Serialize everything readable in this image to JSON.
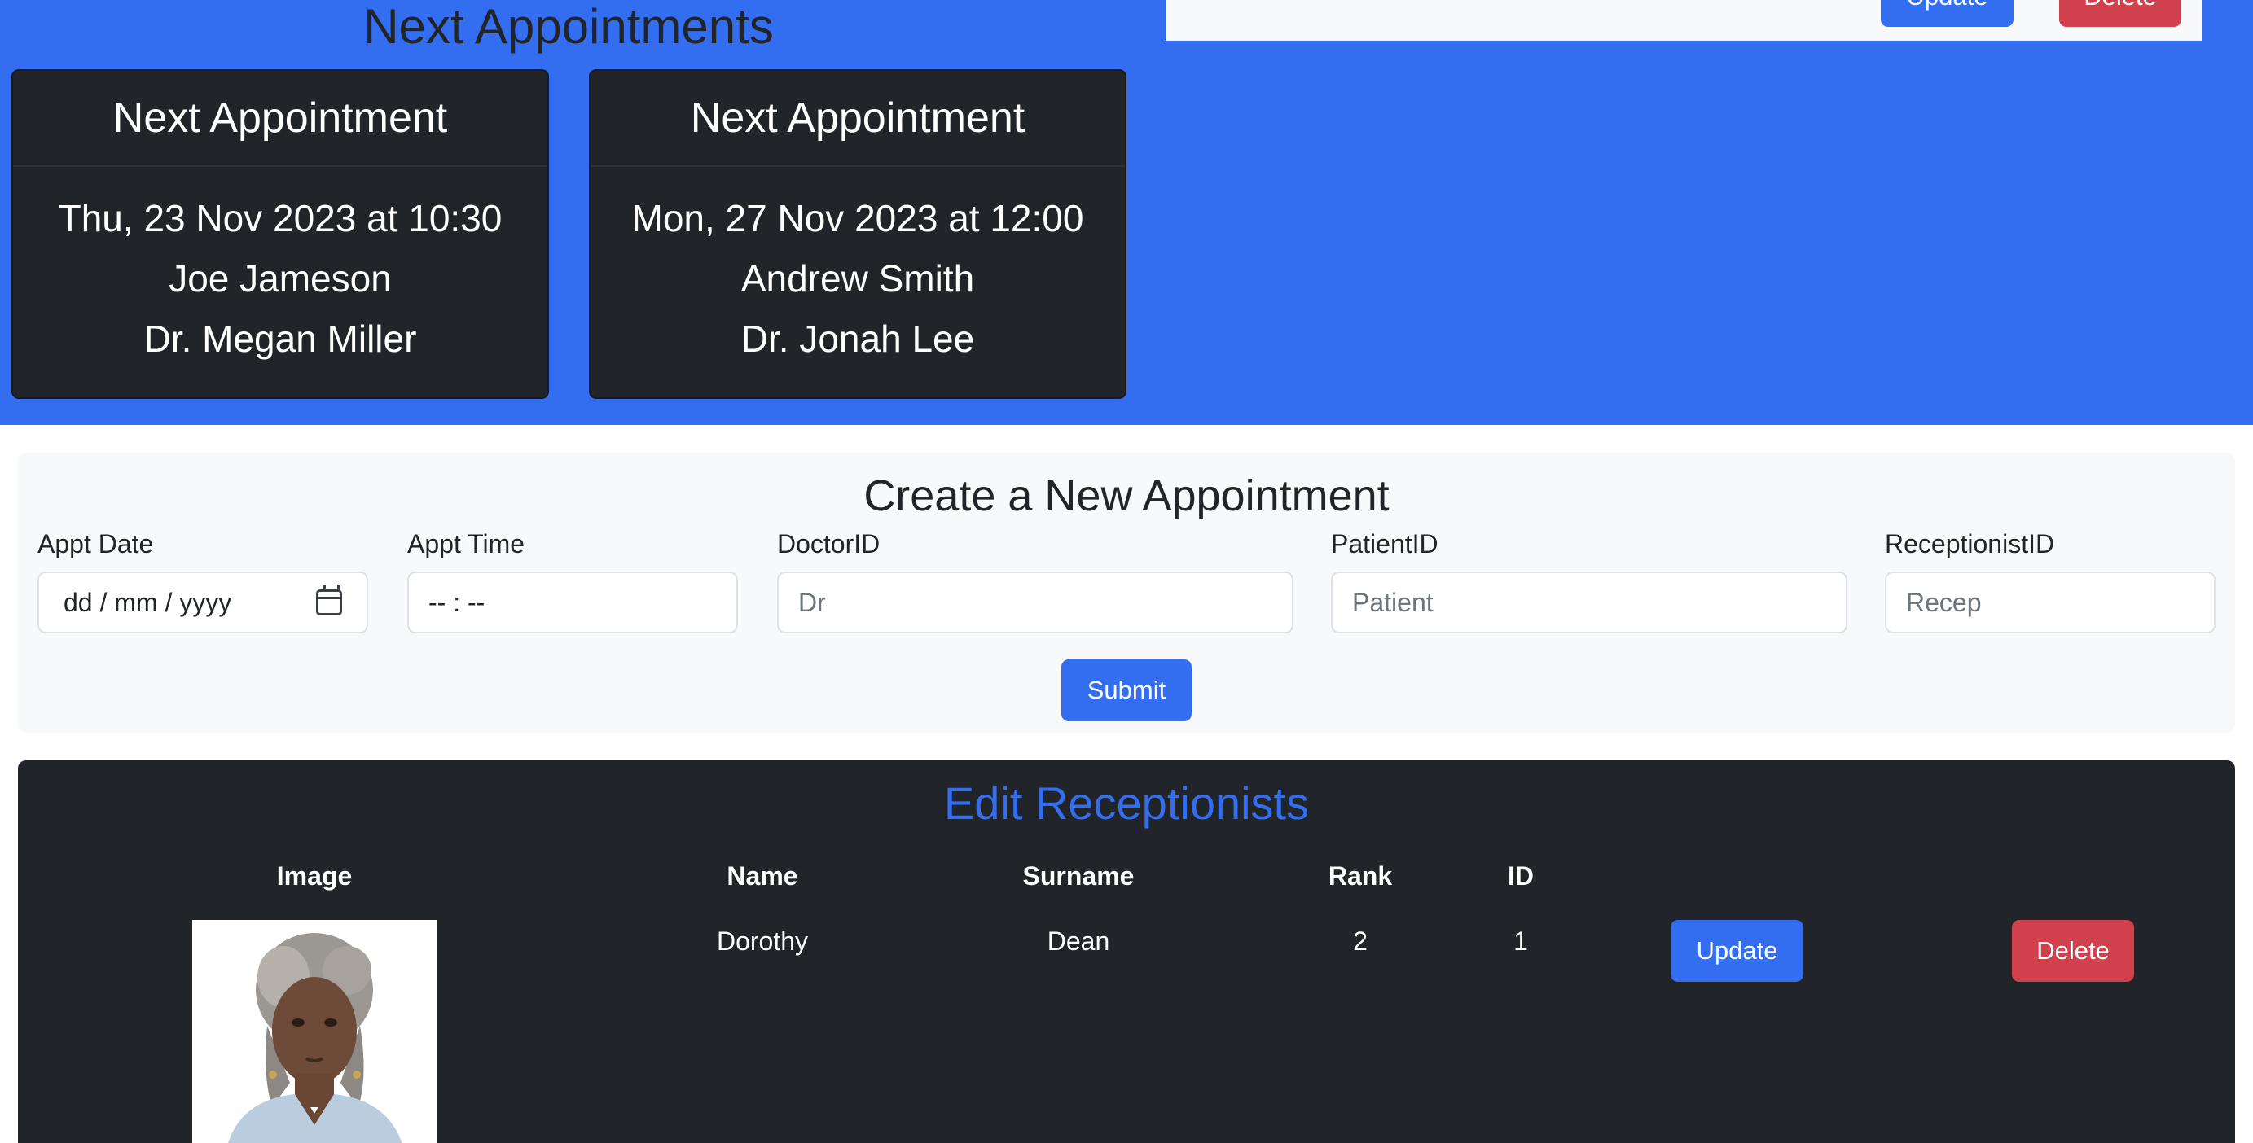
{
  "appointments": {
    "title": "Next Appointments",
    "cards": [
      {
        "header": "Next Appointment",
        "datetime": "Thu, 23 Nov 2023 at 10:30",
        "patient": "Joe Jameson",
        "doctor": "Dr. Megan Miller"
      },
      {
        "header": "Next Appointment",
        "datetime": "Mon, 27 Nov 2023 at 12:00",
        "patient": "Andrew Smith",
        "doctor": "Dr. Jonah Lee"
      }
    ]
  },
  "top_panel": {
    "update_label": "Update",
    "delete_label": "Delete"
  },
  "create_form": {
    "title": "Create a New Appointment",
    "date": {
      "label": "Appt Date",
      "value": "dd / mm / yyyy"
    },
    "time": {
      "label": "Appt Time",
      "value": "-- : --"
    },
    "doctor": {
      "label": "DoctorID",
      "placeholder": "Dr"
    },
    "patient": {
      "label": "PatientID",
      "placeholder": "Patient"
    },
    "receptionist": {
      "label": "ReceptionistID",
      "placeholder": "Recep"
    },
    "submit_label": "Submit"
  },
  "receptionists": {
    "title": "Edit Receptionists",
    "columns": [
      "Image",
      "Name",
      "Surname",
      "Rank",
      "ID"
    ],
    "rows": [
      {
        "name": "Dorothy",
        "surname": "Dean",
        "rank": "2",
        "id": "1",
        "update_label": "Update",
        "delete_label": "Delete"
      }
    ]
  },
  "colors": {
    "primary": "#346ef0",
    "danger": "#d1414d",
    "dark": "#212529",
    "light": "#f8f9fa"
  }
}
